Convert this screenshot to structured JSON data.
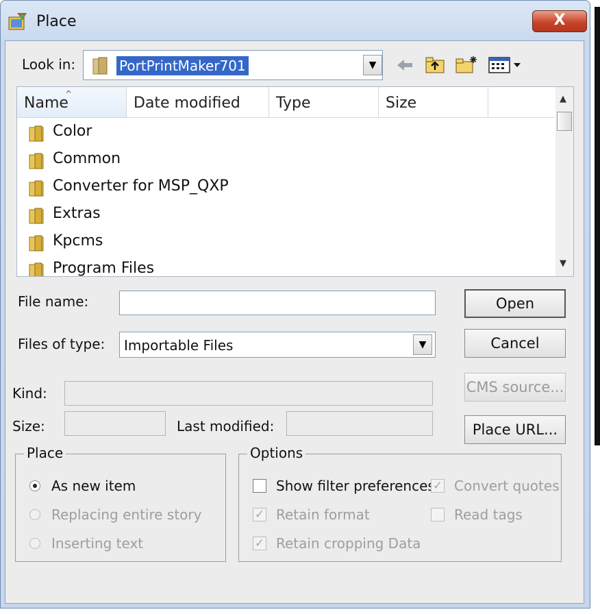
{
  "window": {
    "title": "Place",
    "close_glyph": "X"
  },
  "lookin": {
    "label": "Look in:",
    "value": "PortPrintMaker701"
  },
  "toolbar": {
    "icons": [
      "back-icon",
      "up-folder-icon",
      "new-folder-icon",
      "view-menu-icon"
    ]
  },
  "list": {
    "columns": [
      "Name",
      "Date modified",
      "Type",
      "Size"
    ],
    "items": [
      {
        "name": "Color"
      },
      {
        "name": "Common"
      },
      {
        "name": "Converter for MSP_QXP"
      },
      {
        "name": "Extras"
      },
      {
        "name": "Kpcms"
      },
      {
        "name": "Program Files"
      }
    ]
  },
  "file_name": {
    "label": "File name:",
    "value": ""
  },
  "file_type": {
    "label": "Files of type:",
    "value": "Importable Files"
  },
  "info": {
    "kind_label": "Kind:",
    "size_label": "Size:",
    "last_modified_label": "Last modified:"
  },
  "buttons": {
    "open": "Open",
    "cancel": "Cancel",
    "cms_source": "CMS source...",
    "place_url": "Place URL..."
  },
  "place_group": {
    "title": "Place",
    "options": [
      {
        "label": "As new item",
        "selected": true,
        "enabled": true
      },
      {
        "label": "Replacing entire story",
        "selected": false,
        "enabled": false
      },
      {
        "label": "Inserting text",
        "selected": false,
        "enabled": false
      }
    ]
  },
  "options_group": {
    "title": "Options",
    "show_filter": {
      "label": "Show filter preferences",
      "checked": false,
      "enabled": true
    },
    "convert_quotes": {
      "label": "Convert quotes",
      "checked": true,
      "enabled": false
    },
    "retain_format": {
      "label": "Retain format",
      "checked": true,
      "enabled": false
    },
    "read_tags": {
      "label": "Read tags",
      "checked": false,
      "enabled": false
    },
    "retain_cropping": {
      "label": "Retain cropping Data",
      "checked": true,
      "enabled": false
    }
  }
}
